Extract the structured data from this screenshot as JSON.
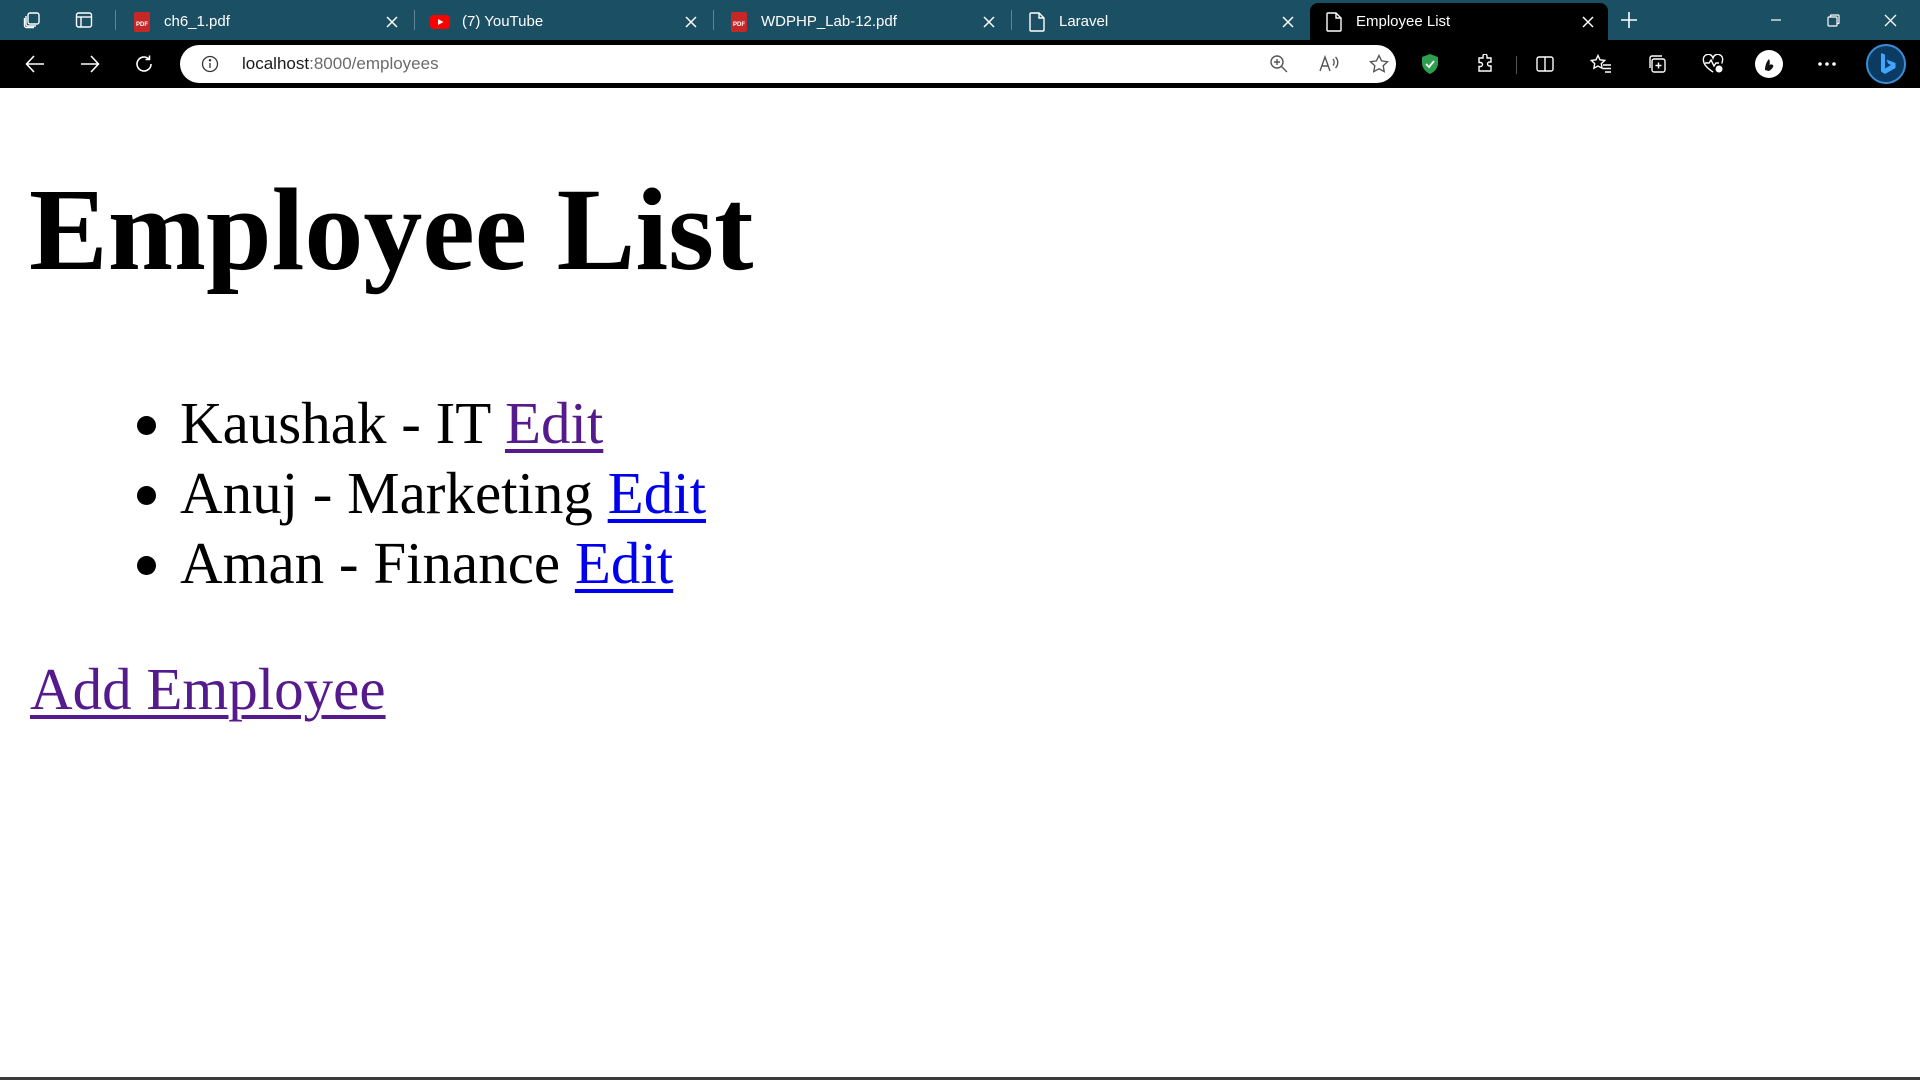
{
  "browser": {
    "tabs": [
      {
        "title": "ch6_1.pdf",
        "icon": "pdf-icon",
        "active": false
      },
      {
        "title": "(7) YouTube",
        "icon": "youtube-icon",
        "active": false
      },
      {
        "title": "WDPHP_Lab-12.pdf",
        "icon": "pdf-icon",
        "active": false
      },
      {
        "title": "Laravel",
        "icon": "page-icon",
        "active": false
      },
      {
        "title": "Employee List",
        "icon": "page-icon",
        "active": true
      }
    ],
    "address": {
      "host": "localhost",
      "path": ":8000/employees"
    },
    "colors": {
      "tabstrip": "#1b4f63",
      "toolbar": "#000000",
      "pdf_icon": "#c62828",
      "youtube_icon": "#ff0000",
      "shield": "#2e9e4f"
    }
  },
  "page": {
    "title": "Employee List",
    "employees": [
      {
        "text": "Kaushak - IT",
        "edit_label": "Edit",
        "visited": true
      },
      {
        "text": "Anuj - Marketing",
        "edit_label": "Edit",
        "visited": false
      },
      {
        "text": "Aman - Finance",
        "edit_label": "Edit",
        "visited": false
      }
    ],
    "add_label": "Add Employee",
    "link_colors": {
      "visited": "#551a8b",
      "unvisited": "#0000ee"
    }
  }
}
